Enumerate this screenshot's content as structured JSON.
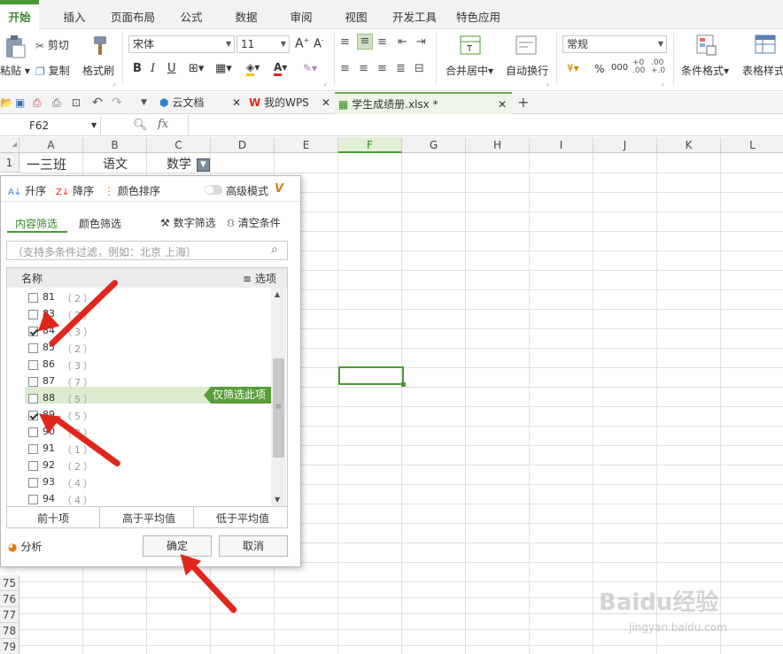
{
  "menu": {
    "tabs": [
      "开始",
      "插入",
      "页面布局",
      "公式",
      "数据",
      "审阅",
      "视图",
      "开发工具",
      "特色应用"
    ]
  },
  "ribbon": {
    "paste": "粘贴",
    "cut": "剪切",
    "copy": "复制",
    "format_painter": "格式刷",
    "font_name": "宋体",
    "font_size": "11",
    "bold": "B",
    "italic": "I",
    "underline": "U",
    "merge_center": "合并居中",
    "wrap_text": "自动换行",
    "number_format": "常规",
    "percent": "%",
    "comma": "000",
    "cond_format": "条件格式",
    "table_style": "表格样式"
  },
  "doc_tabs": {
    "cloud": "云文档",
    "wps": "我的WPS",
    "file": "学生成绩册.xlsx *"
  },
  "formula": {
    "name_box": "F62",
    "fx": "fx",
    "value": ""
  },
  "grid": {
    "columns": [
      "A",
      "B",
      "C",
      "D",
      "E",
      "F",
      "G",
      "H",
      "I",
      "J",
      "K",
      "L"
    ],
    "selected_column": "F",
    "row1": {
      "num": "1",
      "a": "一三班",
      "b": "语文",
      "c": "数学"
    },
    "bottom_rows": [
      "75",
      "76",
      "77",
      "78",
      "79"
    ]
  },
  "filter_panel": {
    "sort_asc": "升序",
    "sort_desc": "降序",
    "color_sort": "颜色排序",
    "advanced_mode": "高级模式",
    "tab_content": "内容筛选",
    "tab_color": "颜色筛选",
    "number_filter": "数字筛选",
    "clear_filter": "清空条件",
    "search_placeholder": "（支持多条件过滤，例如：北京  上海）",
    "list_header": "名称",
    "options": "选项",
    "items": [
      {
        "value": "81",
        "count": "（2）",
        "checked": false
      },
      {
        "value": "83",
        "count": "（2）",
        "checked": false
      },
      {
        "value": "84",
        "count": "（3）",
        "checked": true
      },
      {
        "value": "85",
        "count": "（2）",
        "checked": false
      },
      {
        "value": "86",
        "count": "（3）",
        "checked": false
      },
      {
        "value": "87",
        "count": "（7）",
        "checked": false
      },
      {
        "value": "88",
        "count": "（5）",
        "checked": false
      },
      {
        "value": "89",
        "count": "（5）",
        "checked": true
      },
      {
        "value": "90",
        "count": "（3）",
        "checked": false
      },
      {
        "value": "91",
        "count": "（1）",
        "checked": false
      },
      {
        "value": "92",
        "count": "（2）",
        "checked": false
      },
      {
        "value": "93",
        "count": "（4）",
        "checked": false
      },
      {
        "value": "94",
        "count": "（4）",
        "checked": false
      }
    ],
    "only_this": "仅筛选此项",
    "top10": "前十项",
    "above_avg": "高于平均值",
    "below_avg": "低于平均值",
    "analysis": "分析",
    "ok": "确定",
    "cancel": "取消"
  },
  "watermark": {
    "brand": "Baidu经验",
    "url": "jingyan.baidu.com"
  },
  "colors": {
    "accent": "#4a9b33",
    "arrow": "#e0261c",
    "highlight": "#dbeccf"
  }
}
